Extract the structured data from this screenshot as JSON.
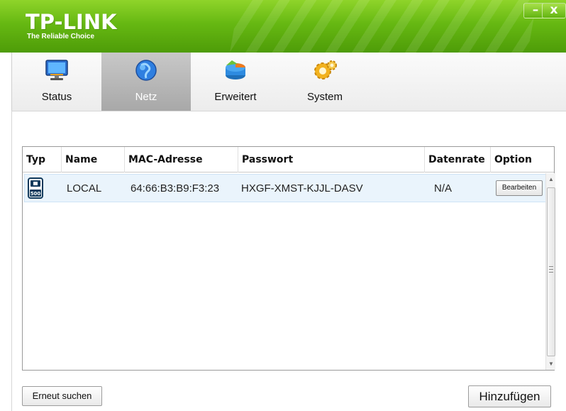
{
  "brand": {
    "name": "TP-LINK",
    "tagline": "The Reliable Choice",
    "color": "#5fb014"
  },
  "window_controls": {
    "minimize_label": "–",
    "close_label": "x"
  },
  "tabs": [
    {
      "label": "Status",
      "icon": "monitor-icon",
      "active": false
    },
    {
      "label": "Netz",
      "icon": "globe-icon",
      "active": true
    },
    {
      "label": "Erweitert",
      "icon": "pie-chart-icon",
      "active": false
    },
    {
      "label": "System",
      "icon": "gear-icon",
      "active": false
    }
  ],
  "table": {
    "columns": [
      "Typ",
      "Name",
      "MAC-Adresse",
      "Passwort",
      "Datenrate",
      "Option"
    ],
    "rows": [
      {
        "type_icon": "powerline-adapter-icon",
        "type_icon_text": "500",
        "name": "LOCAL",
        "mac": "64:66:B3:B9:F3:23",
        "password": "HXGF-XMST-KJJL-DASV",
        "rate": "N/A",
        "option_label": "Bearbeiten"
      }
    ]
  },
  "buttons": {
    "rescan_label": "Erneut suchen",
    "add_label": "Hinzufügen"
  }
}
